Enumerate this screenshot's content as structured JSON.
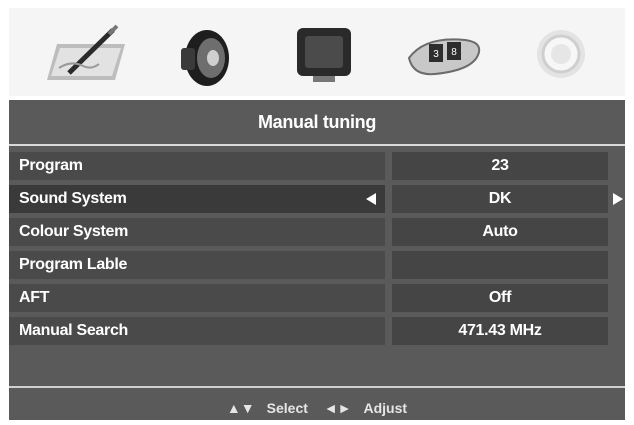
{
  "icons": [
    {
      "name": "picture-icon"
    },
    {
      "name": "sound-icon"
    },
    {
      "name": "screen-icon"
    },
    {
      "name": "channel-icon"
    },
    {
      "name": "settings-icon"
    }
  ],
  "menu": {
    "title": "Manual tuning",
    "rows": [
      {
        "label": "Program",
        "value": "23"
      },
      {
        "label": "Sound System",
        "value": "DK"
      },
      {
        "label": "Colour System",
        "value": "Auto"
      },
      {
        "label": "Program Lable",
        "value": ""
      },
      {
        "label": "AFT",
        "value": "Off"
      },
      {
        "label": "Manual Search",
        "value": "471.43 MHz"
      }
    ]
  },
  "footer": {
    "select_glyph": "▲▼",
    "select_label": "Select",
    "adjust_glyph": "◄►",
    "adjust_label": "Adjust"
  },
  "colors": {
    "panel_bg": "#5a5a5a",
    "row_bg": "#4a4a4a",
    "value_bg": "#454545",
    "text": "#ffffff"
  }
}
